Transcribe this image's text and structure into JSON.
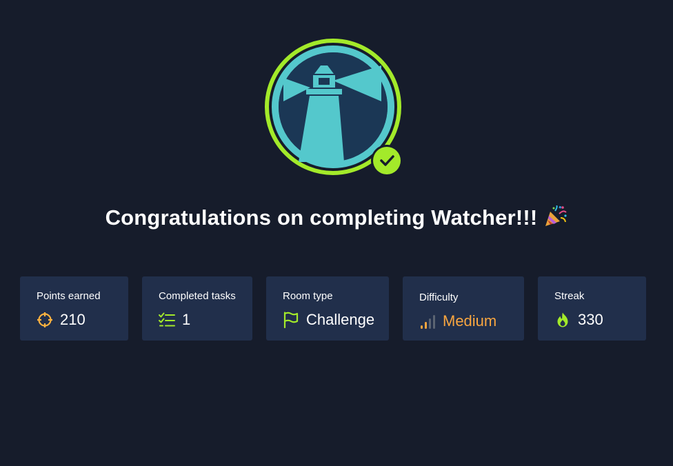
{
  "colors": {
    "background": "#161c2b",
    "card": "#212f4b",
    "accent_green": "#a3ea2a",
    "points_orange": "#ffb340",
    "difficulty_orange": "#f9a640",
    "badge_inner": "#1b3755",
    "badge_figure": "#54c8cc"
  },
  "headline": "Congratulations on completing Watcher!!!",
  "badge": {
    "icon": "lighthouse-icon",
    "status_icon": "check-icon"
  },
  "stats": [
    {
      "label": "Points earned",
      "value": "210",
      "icon": "crosshair-icon"
    },
    {
      "label": "Completed tasks",
      "value": "1",
      "icon": "checklist-icon"
    },
    {
      "label": "Room type",
      "value": "Challenge",
      "icon": "flag-icon"
    },
    {
      "label": "Difficulty",
      "value": "Medium",
      "icon": "signal-bars-icon"
    },
    {
      "label": "Streak",
      "value": "330",
      "icon": "flame-icon"
    }
  ]
}
